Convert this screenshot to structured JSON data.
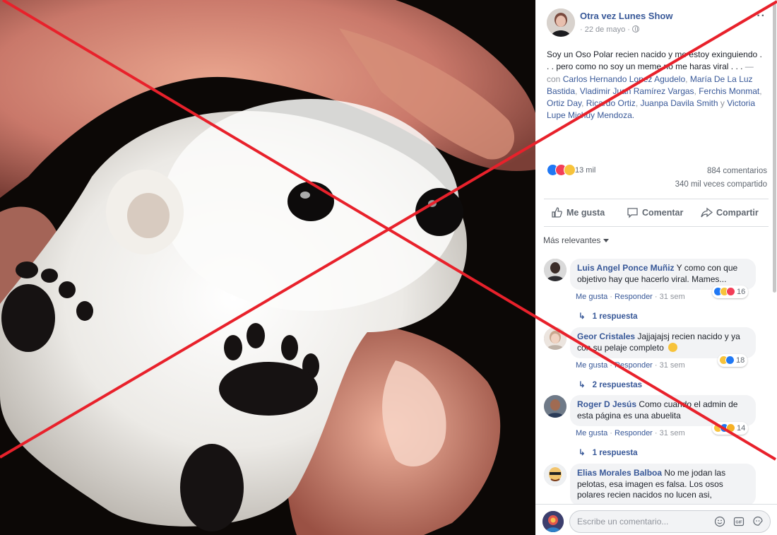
{
  "post": {
    "page_name": "Otra vez Lunes Show",
    "date": "· 22 de mayo ·",
    "more_label": "···",
    "text_main": "Soy un Oso Polar recien nacido y me estoy exinguiendo . . . pero como no soy un meme no me haras viral . . .",
    "with_prefix": " — con ",
    "tags": [
      "Carlos Hernando Lopez Agudelo",
      "María De La Luz Bastida",
      "Vladimir Juan Ramírez Vargas",
      "Ferchis Monmat",
      "Ortiz Day",
      "Ricardo Ortiz",
      "Juanpa Davila Smith",
      "Victoria Lupe Michuy Mendoza"
    ],
    "tag_sep": ", ",
    "tag_and": " y ",
    "tag_end": "."
  },
  "stats": {
    "reaction_icons": [
      "like",
      "love",
      "sad"
    ],
    "reactions": "13 mil",
    "comments": "884 comentarios",
    "shares": "340 mil veces compartido"
  },
  "actions": {
    "like": "Me gusta",
    "comment": "Comentar",
    "share": "Compartir"
  },
  "sort_label": "Más relevantes",
  "comments": [
    {
      "author": "Luis Angel Ponce Muñiz",
      "text": " Y como con que objetivo hay que hacerlo viral. Mames...",
      "like": "Me gusta",
      "reply": "Responder",
      "time": "31 sem",
      "reaction_count": "16",
      "reaction_icons": [
        "like",
        "haha",
        "love"
      ],
      "replies": "1 respuesta"
    },
    {
      "author": "Geor Cristales",
      "text": " Jajjajajsj recien nacido y ya con su pelaje completo",
      "emoji": "laughing-face",
      "like": "Me gusta",
      "reply": "Responder",
      "time": "31 sem",
      "reaction_count": "18",
      "reaction_icons": [
        "haha",
        "like"
      ],
      "replies": "2 respuestas"
    },
    {
      "author": "Roger D Jesús",
      "text": " Como cuando el admin de esta página es una abuelita",
      "like": "Me gusta",
      "reply": "Responder",
      "time": "31 sem",
      "reaction_count": "14",
      "reaction_icons": [
        "haha",
        "like",
        "wow"
      ],
      "replies": "1 respuesta"
    },
    {
      "author": "Elias Morales Balboa",
      "text": " No me jodan las pelotas, esa imagen es falsa. Los osos polares recien nacidos no lucen asi,"
    }
  ],
  "composer": {
    "placeholder": "Escribe un comentario...",
    "icons": [
      "emoji-icon",
      "gif-icon",
      "sticker-icon"
    ]
  },
  "colors": {
    "link": "#385898",
    "overlay_x": "#e8212b",
    "like": "#2078f4",
    "love": "#f33e58",
    "haha": "#f7c33b"
  }
}
